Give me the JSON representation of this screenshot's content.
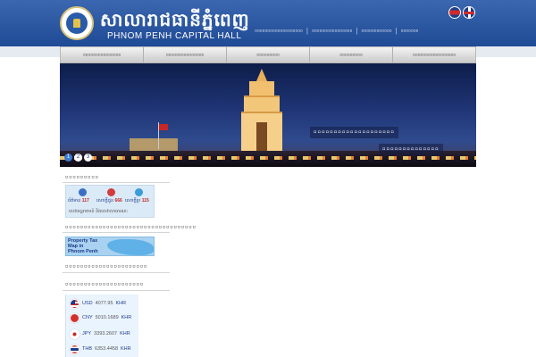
{
  "header": {
    "title_km": "សាលារាជធានីភ្នំពេញ",
    "subtitle": "PHNOM PENH CAPITAL HALL",
    "top_links": [
      "▫▫▫▫▫▫▫▫▫▫▫▫▫▫▫▫▫▫▫",
      "▫▫▫▫▫▫▫▫▫▫▫▫▫▫▫▫",
      "▫▫▫▫▫▫▫▫▫▫▫▫",
      "▫▫▫▫▫▫▫"
    ],
    "separator": "|",
    "languages": [
      "khmer-flag-icon",
      "uk-flag-icon"
    ]
  },
  "menu": {
    "items": [
      "▫▫▫▫▫▫▫▫▫▫▫▫▫▫▫",
      "▫▫▫▫▫▫▫▫▫▫▫▫▫▫▫",
      "▫▫▫▫▫▫▫▫▫",
      "▫▫▫▫▫▫▫▫▫",
      "▫▫▫▫▫▫▫▫▫▫▫▫▫▫▫▫▫"
    ]
  },
  "banner": {
    "caption_1": "▫▫▫▫▫▫▫▫▫▫▫▫▫▫▫▫▫▫▫▫",
    "caption_2": "▫▫▫▫▫▫▫▫▫▫▫▫▫▫",
    "slides": [
      "1",
      "2",
      "3"
    ],
    "active_slide": 1
  },
  "sidebar": {
    "section_1_title": "▫▫▫▫▫▫▫▫▫",
    "news": {
      "items": [
        {
          "label": "ព័ត៌មាន",
          "count": "117"
        },
        {
          "label": "សេចក្តីជូន",
          "count": "666"
        },
        {
          "label": "សេចក្តីប្រ",
          "count": "115"
        }
      ],
      "footer": "សេវាអន្តរាគមន៍ និងសេវាសាធារណៈ"
    },
    "section_2_title": "▫▫▫▫▫▫▫▫▫▫▫▫▫▫▫▫▫▫▫▫▫▫▫▫▫▫▫▫▫▫▫▫▫▫▫",
    "map_banner": "Property Tax Map in Phnom Penh",
    "section_3_title": "▫▫▫▫▫▫▫▫▫▫▫▫▫▫▫▫▫▫▫▫▫▫",
    "section_4_title": "▫▫▫▫▫▫▫▫▫▫▫▫▫▫▫▫▫▫▫▫▫",
    "exchange_rates": [
      {
        "currency": "USD",
        "rate": "4077.95",
        "unit": "KHR"
      },
      {
        "currency": "CNY",
        "rate": "5010.1689",
        "unit": "KHR"
      },
      {
        "currency": "JPY",
        "rate": "3393.2607",
        "unit": "KHR"
      },
      {
        "currency": "THB",
        "rate": "6353.4458",
        "unit": "KHR"
      }
    ]
  },
  "colors": {
    "header_blue": "#2f5aa1",
    "menu_grey": "#d8d8d8",
    "accent_red": "#c62828"
  }
}
